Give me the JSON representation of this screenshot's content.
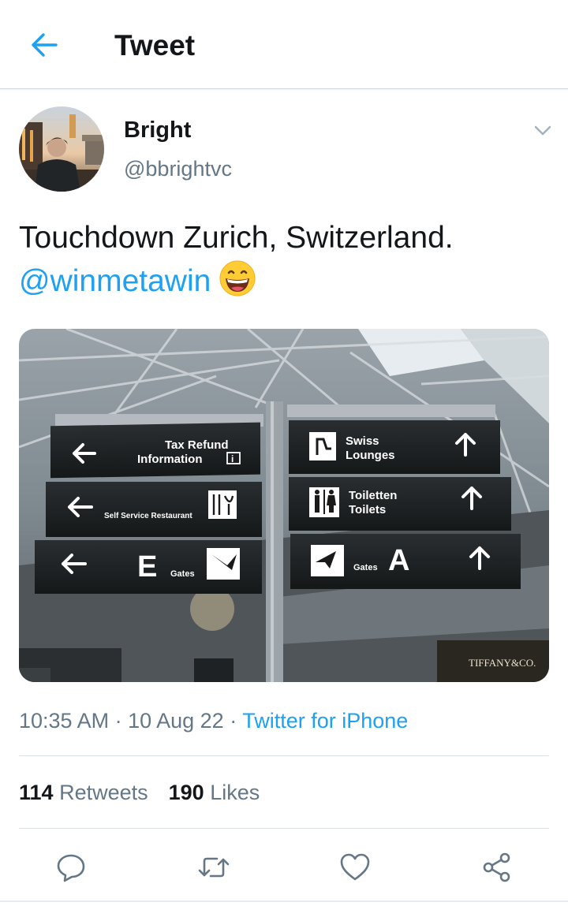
{
  "header": {
    "title": "Tweet",
    "back_icon": "arrow-left-icon"
  },
  "tweet": {
    "author": {
      "name": "Bright",
      "handle": "@bbrightvc"
    },
    "text": "Touchdown Zurich, Switzerland.",
    "mention": "@winmetawin",
    "emoji": "grinning-face-emoji",
    "media": {
      "signs": {
        "tax_refund": "Tax Refund",
        "information": "Information",
        "self_service": "Self Service Restaurant",
        "gate_e": "E",
        "gates_left": "Gates",
        "swiss": "Swiss",
        "lounges": "Lounges",
        "toiletten": "Toiletten",
        "toilets": "Toilets",
        "gates_right": "Gates",
        "gate_a": "A",
        "store": "TIFFANY&CO."
      }
    },
    "timestamp": "10:35 AM · 10 Aug 22 · ",
    "source": "Twitter for iPhone",
    "stats": {
      "retweets_count": "114",
      "retweets_label": "Retweets",
      "likes_count": "190",
      "likes_label": "Likes"
    }
  },
  "actions": {
    "reply_icon": "reply-icon",
    "retweet_icon": "retweet-icon",
    "like_icon": "heart-icon",
    "share_icon": "share-icon"
  },
  "colors": {
    "accent": "#1da1f2",
    "text_primary": "#14171a",
    "text_secondary": "#657786"
  }
}
